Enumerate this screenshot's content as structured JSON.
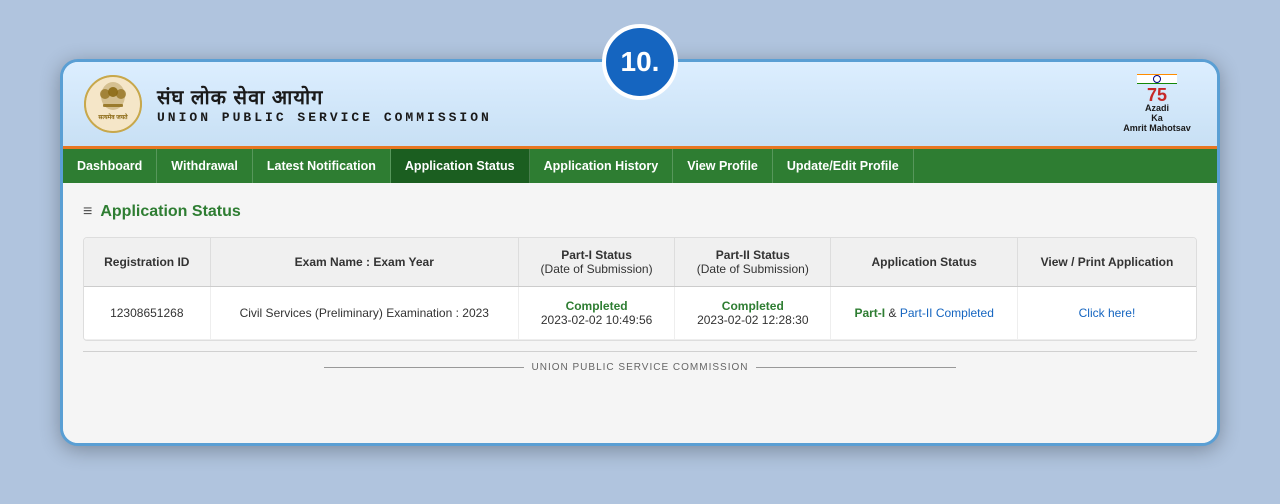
{
  "badge": {
    "label": "10."
  },
  "header": {
    "title_hindi": "संघ लोक सेवा आयोग",
    "title_english": "UNION PUBLIC SERVICE COMMISSION",
    "azadi_line1": "Azadi",
    "azadi_line2": "Ka",
    "azadi_line3": "Amrit Mahotsav"
  },
  "nav": {
    "items": [
      {
        "label": "Dashboard",
        "active": false
      },
      {
        "label": "Withdrawal",
        "active": false
      },
      {
        "label": "Latest Notification",
        "active": false
      },
      {
        "label": "Application Status",
        "active": true
      },
      {
        "label": "Application History",
        "active": false
      },
      {
        "label": "View Profile",
        "active": false
      },
      {
        "label": "Update/Edit Profile",
        "active": false
      }
    ]
  },
  "section": {
    "title": "Application Status",
    "icon": "≡"
  },
  "table": {
    "headers": [
      "Registration ID",
      "Exam Name : Exam Year",
      "Part-I Status\n(Date of Submission)",
      "Part-II Status\n(Date of Submission)",
      "Application Status",
      "View / Print Application"
    ],
    "rows": [
      {
        "registration_id": "12308651268",
        "exam_name": "Civil Services (Preliminary) Examination : 2023",
        "part1_status": "Completed",
        "part1_date": "2023-02-02 10:49:56",
        "part2_status": "Completed",
        "part2_date": "2023-02-02 12:28:30",
        "application_status_prefix": "Part-I",
        "application_status_amp": " & ",
        "application_status_link": "Part-II Completed",
        "view_link": "Click here!"
      }
    ]
  },
  "footer": {
    "text": "UNION PUBLIC SERVICE COMMISSION"
  }
}
